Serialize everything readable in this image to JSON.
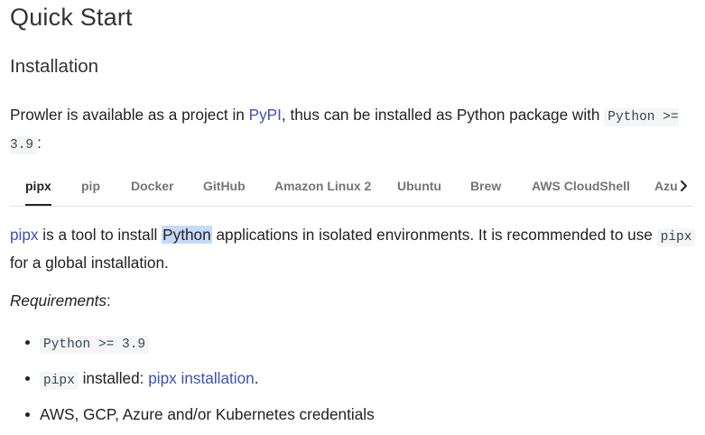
{
  "title": "Quick Start",
  "section": "Installation",
  "intro": {
    "before": "Prowler is available as a project in ",
    "link": "PyPI",
    "middle": ", thus can be installed as Python package with ",
    "code": "Python >= 3.9",
    "after": ":"
  },
  "tabs": [
    "pipx",
    "pip",
    "Docker",
    "GitHub",
    "Amazon Linux 2",
    "Ubuntu",
    "Brew",
    "AWS CloudShell",
    "Azu"
  ],
  "active_tab": "pipx",
  "tab_scroll_icon": "chevron-right-icon",
  "description": {
    "link": "pipx",
    "part1": " is a tool to install ",
    "highlight": "Python",
    "part2": " applications in isolated environments. It is recommended to use ",
    "code": "pipx",
    "part3": " for a global installation."
  },
  "requirements": {
    "label": "Requirements",
    "colon": ":"
  },
  "list": {
    "item1_code": "Python >= 3.9",
    "item2_code": "pipx",
    "item2_text": " installed: ",
    "item2_link": "pipx installation",
    "item2_end": ".",
    "item3_text": "AWS, GCP, Azure and/or Kubernetes credentials"
  },
  "colors": {
    "link": "#3f51b5",
    "highlight": "#c8dafc",
    "code_bg": "#f5f5f5"
  }
}
